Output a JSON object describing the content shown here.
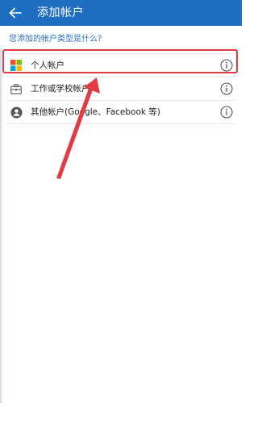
{
  "appbar": {
    "title": "添加帐户",
    "back_icon": "arrow-left-icon",
    "background": "#1e6ec4"
  },
  "prompt": {
    "question": "您添加的帐户类型是什么?"
  },
  "accounts": [
    {
      "label": "个人帐户",
      "icon": "microsoft-logo-icon",
      "info_icon": "info-icon"
    },
    {
      "label": "工作或学校帐户",
      "icon": "briefcase-icon",
      "info_icon": "info-icon"
    },
    {
      "label": "其他帐户(Google、Facebook 等)",
      "icon": "person-circle-icon",
      "info_icon": "info-icon"
    }
  ],
  "annotation": {
    "color": "#e23b45"
  }
}
